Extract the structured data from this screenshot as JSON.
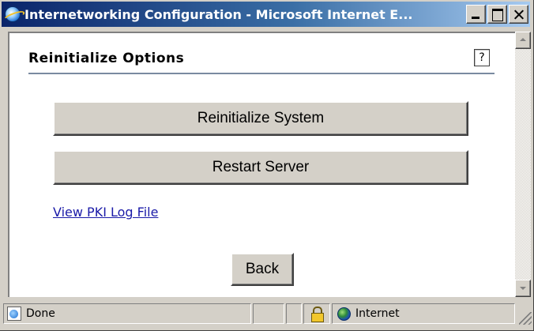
{
  "window": {
    "title": "Internetworking Configuration - Microsoft Internet E...",
    "icon": "internet-explorer-icon"
  },
  "page": {
    "heading": "Reinitialize Options",
    "help_label": "?",
    "buttons": {
      "reinitialize_system": "Reinitialize System",
      "restart_server": "Restart Server",
      "back": "Back"
    },
    "link_view_pki_log": "View PKI Log File"
  },
  "statusbar": {
    "status_text": "Done",
    "zone": "Internet"
  },
  "colors": {
    "titlebar_start": "#0a246a",
    "titlebar_end": "#a6caf0",
    "link": "#1a1aa8",
    "face": "#d4d0c8"
  }
}
